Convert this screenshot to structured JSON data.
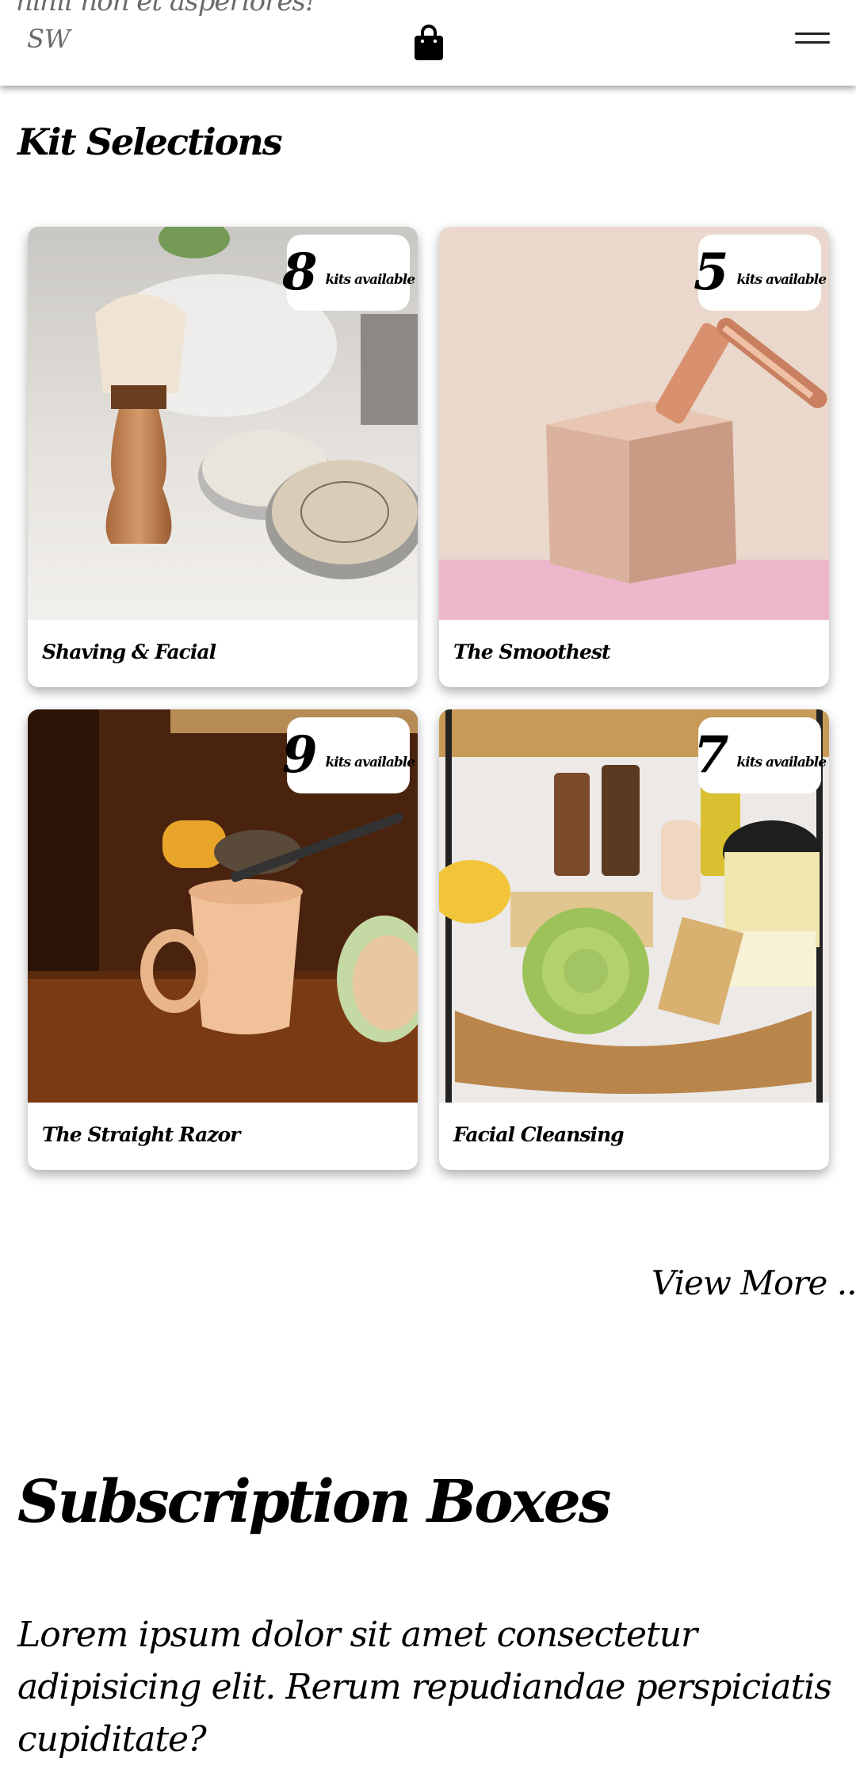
{
  "header": {
    "tagline": "nihil non et asperiores!",
    "logo": "SW",
    "cart_icon": "shopping-bag-icon",
    "menu_icon": "hamburger-menu-icon"
  },
  "kits": {
    "title": "Kit Selections",
    "badge_suffix": "kits available",
    "items": [
      {
        "count": "8",
        "label": "Shaving & Facial",
        "image": "shaving-brush-and-soap-tins-photo"
      },
      {
        "count": "5",
        "label": "The Smoothest",
        "image": "safety-razor-on-soap-bar-photo"
      },
      {
        "count": "9",
        "label": "The Straight Razor",
        "image": "shaving-mug-and-brush-photo"
      },
      {
        "count": "7",
        "label": "Facial Cleansing",
        "image": "skincare-basket-photo"
      }
    ],
    "view_more": "View More ..."
  },
  "subscriptions": {
    "title": "Subscription Boxes",
    "body": "Lorem ipsum dolor sit amet consectetur adipisicing elit. Rerum repudiandae perspiciatis cupiditate?"
  }
}
